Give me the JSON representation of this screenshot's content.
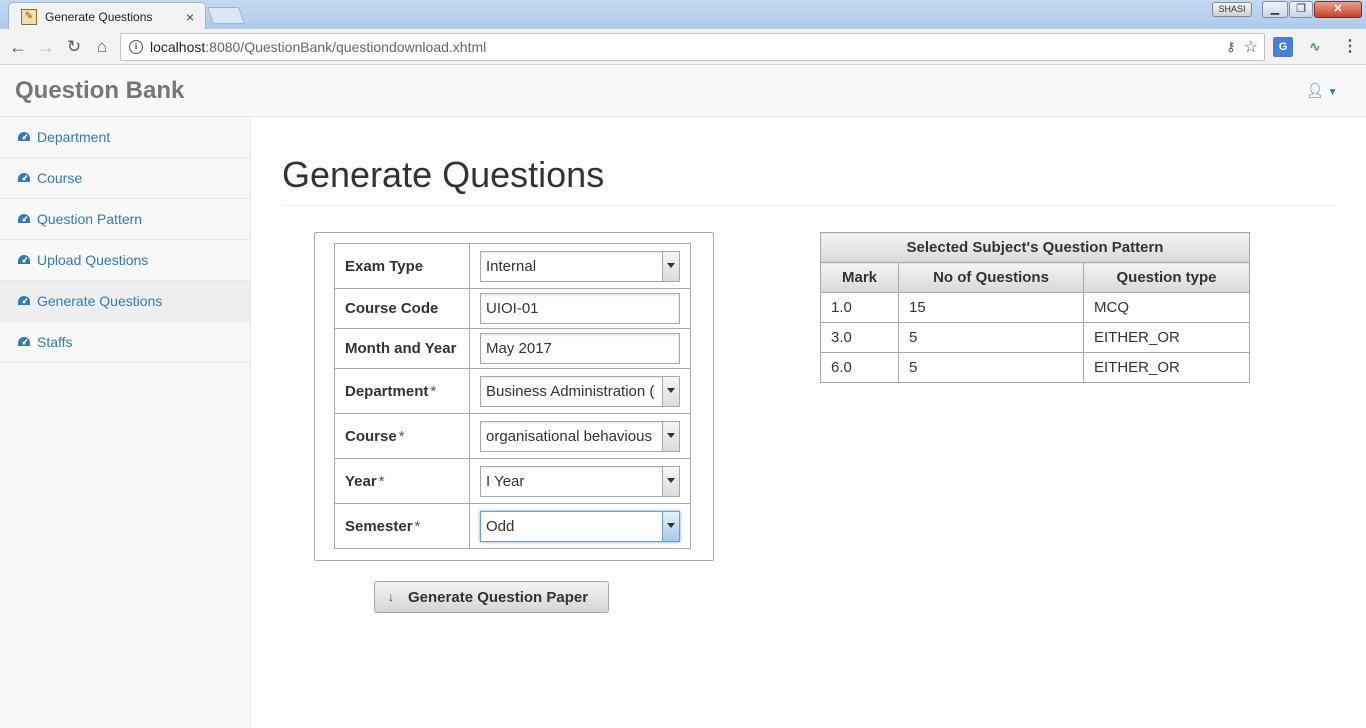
{
  "browser": {
    "tab_title": "Generate Questions",
    "tab_close": "×",
    "profile_name": "SHASI",
    "url_host": "localhost",
    "url_rest": ":8080/QuestionBank/questiondownload.xhtml",
    "icons": {
      "back": "arrow-left-icon",
      "forward": "arrow-right-icon",
      "reload": "reload-icon",
      "home": "home-icon",
      "info": "info-icon",
      "key": "key-icon",
      "star": "star-icon",
      "translate": "translate-icon",
      "menu": "menu-dots-icon"
    }
  },
  "app": {
    "brand": "Question Bank",
    "user_icon": "user-icon"
  },
  "sidebar": {
    "items": [
      {
        "label": "Department",
        "icon": "dashboard-icon"
      },
      {
        "label": "Course",
        "icon": "dashboard-icon"
      },
      {
        "label": "Question Pattern",
        "icon": "dashboard-icon"
      },
      {
        "label": "Upload Questions",
        "icon": "dashboard-icon"
      },
      {
        "label": "Generate Questions",
        "icon": "dashboard-icon",
        "active": true
      },
      {
        "label": "Staffs",
        "icon": "dashboard-icon"
      }
    ]
  },
  "main": {
    "title": "Generate Questions",
    "form": {
      "exam_type": {
        "label": "Exam Type",
        "value": "Internal"
      },
      "course_code": {
        "label": "Course Code",
        "value": "UIOI-01"
      },
      "month_year": {
        "label": "Month and Year",
        "value": "May 2017"
      },
      "department": {
        "label": "Department",
        "required": "*",
        "value": "Business Administration ("
      },
      "course": {
        "label": "Course",
        "required": "*",
        "value": "organisational behavious"
      },
      "year": {
        "label": "Year",
        "required": "*",
        "value": "I Year"
      },
      "semester": {
        "label": "Semester",
        "required": "*",
        "value": "Odd"
      }
    },
    "generate_button": {
      "label": "Generate Question Paper",
      "icon": "↓"
    }
  },
  "pattern_table": {
    "caption": "Selected Subject's Question Pattern",
    "headers": [
      "Mark",
      "No of Questions",
      "Question type"
    ],
    "rows": [
      [
        "1.0",
        "15",
        "MCQ"
      ],
      [
        "3.0",
        "5",
        "EITHER_OR"
      ],
      [
        "6.0",
        "5",
        "EITHER_OR"
      ]
    ]
  },
  "colors": {
    "link": "#337ab7",
    "brand_text": "#777777",
    "border": "#a8a8a8"
  }
}
